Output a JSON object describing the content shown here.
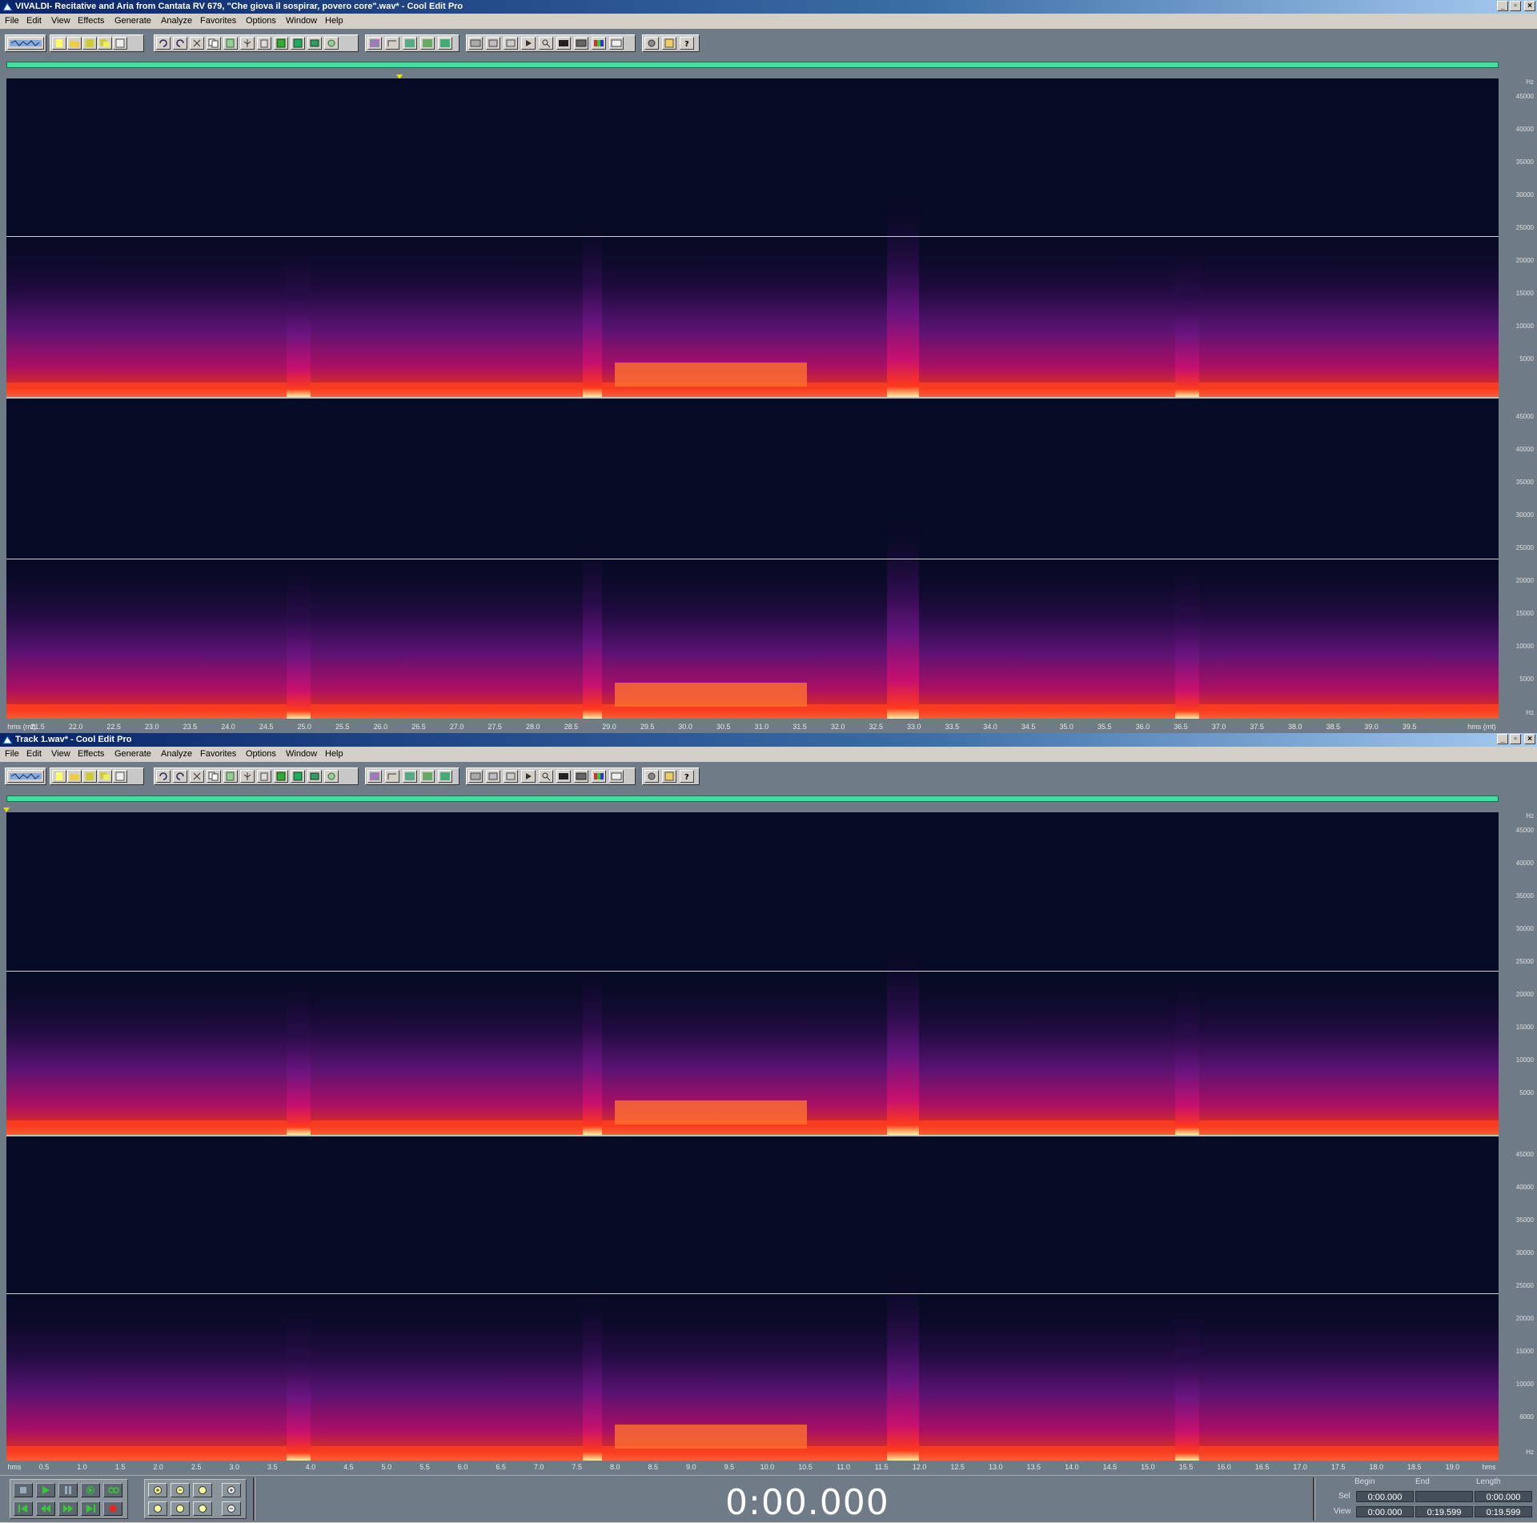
{
  "windows": [
    {
      "title": "VIVALDI- Recitative and Aria from Cantata RV 679, \"Che giova il sospirar, povero core\".wav* - Cool Edit Pro",
      "time_unit_label": "hms (mt)",
      "time_unit_label_right": "hms (mt)",
      "time_ticks": [
        "21.5",
        "22.0",
        "22.5",
        "23.0",
        "23.5",
        "24.0",
        "24.5",
        "25.0",
        "25.5",
        "26.0",
        "26.5",
        "27.0",
        "27.5",
        "28.0",
        "28.5",
        "29.0",
        "29.5",
        "30.0",
        "30.5",
        "31.0",
        "31.5",
        "32.0",
        "32.5",
        "33.0",
        "33.5",
        "34.0",
        "34.5",
        "35.0",
        "35.5",
        "36.0",
        "36.5",
        "37.0",
        "37.5",
        "38.0",
        "38.5",
        "39.0",
        "39.5"
      ]
    },
    {
      "title": "Track 1.wav* - Cool Edit Pro",
      "time_unit_label": "hms",
      "time_unit_label_right": "hms",
      "time_ticks": [
        "0.5",
        "1.0",
        "1.5",
        "2.0",
        "2.5",
        "3.0",
        "3.5",
        "4.0",
        "4.5",
        "5.0",
        "5.5",
        "6.0",
        "6.5",
        "7.0",
        "7.5",
        "8.0",
        "8.5",
        "9.0",
        "9.5",
        "10.0",
        "10.5",
        "11.0",
        "11.5",
        "12.0",
        "12.5",
        "13.0",
        "13.5",
        "14.0",
        "14.5",
        "15.0",
        "15.5",
        "16.0",
        "16.5",
        "17.0",
        "17.5",
        "18.0",
        "18.5",
        "19.0"
      ]
    }
  ],
  "menu": [
    "File",
    "Edit",
    "View",
    "Effects",
    "Generate",
    "Analyze",
    "Favorites",
    "Options",
    "Window",
    "Help"
  ],
  "freq_unit": "Hz",
  "freq_labels": [
    "45000",
    "40000",
    "35000",
    "30000",
    "25000",
    "20000",
    "15000",
    "10000",
    "5000"
  ],
  "freq_labels_last": [
    "45000",
    "40000",
    "35000",
    "30000",
    "25000",
    "20000",
    "15000",
    "10000",
    "6000"
  ],
  "window_buttons": [
    "_",
    "▫",
    "×"
  ],
  "transport": {
    "time": "0:00.000",
    "headers": {
      "begin": "Begin",
      "end": "End",
      "length": "Length"
    },
    "sel": {
      "label": "Sel",
      "begin": "0:00.000",
      "end": "",
      "length": "0:00.000"
    },
    "view": {
      "label": "View",
      "begin": "0:00.000",
      "end": "0:19.599",
      "length": "0:19.599"
    }
  },
  "colors": {
    "spectrum_bg": "#070a24",
    "overview": "#3fe0a0",
    "accent": "#0a246a"
  }
}
